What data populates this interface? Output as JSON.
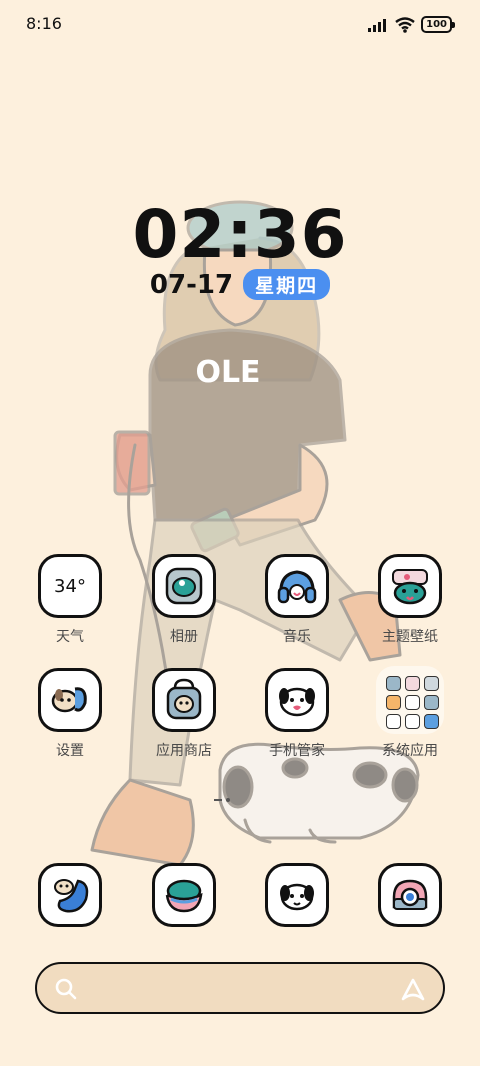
{
  "status_bar": {
    "time": "8:16",
    "battery": "100"
  },
  "clock": {
    "time": "02:36",
    "date": "07-17",
    "weekday": "星期四"
  },
  "wallpaper": {
    "shirt_text": "OLE"
  },
  "apps": {
    "weather": {
      "label": "天气",
      "temp": "34°"
    },
    "photos": {
      "label": "相册"
    },
    "music": {
      "label": "音乐"
    },
    "themes": {
      "label": "主题壁纸"
    },
    "settings": {
      "label": "设置"
    },
    "appstore": {
      "label": "应用商店"
    },
    "security": {
      "label": "手机管家"
    },
    "system_folder": {
      "label": "系统应用"
    }
  },
  "dock": [
    "phone",
    "browser",
    "messages",
    "camera"
  ],
  "search_bar": {
    "left_icon": "search-icon",
    "right_icon": "assistant-icon"
  },
  "colors": {
    "background": "#fdf0dd",
    "accent": "#4b8ff0",
    "search_bg": "#f1dcc0"
  }
}
